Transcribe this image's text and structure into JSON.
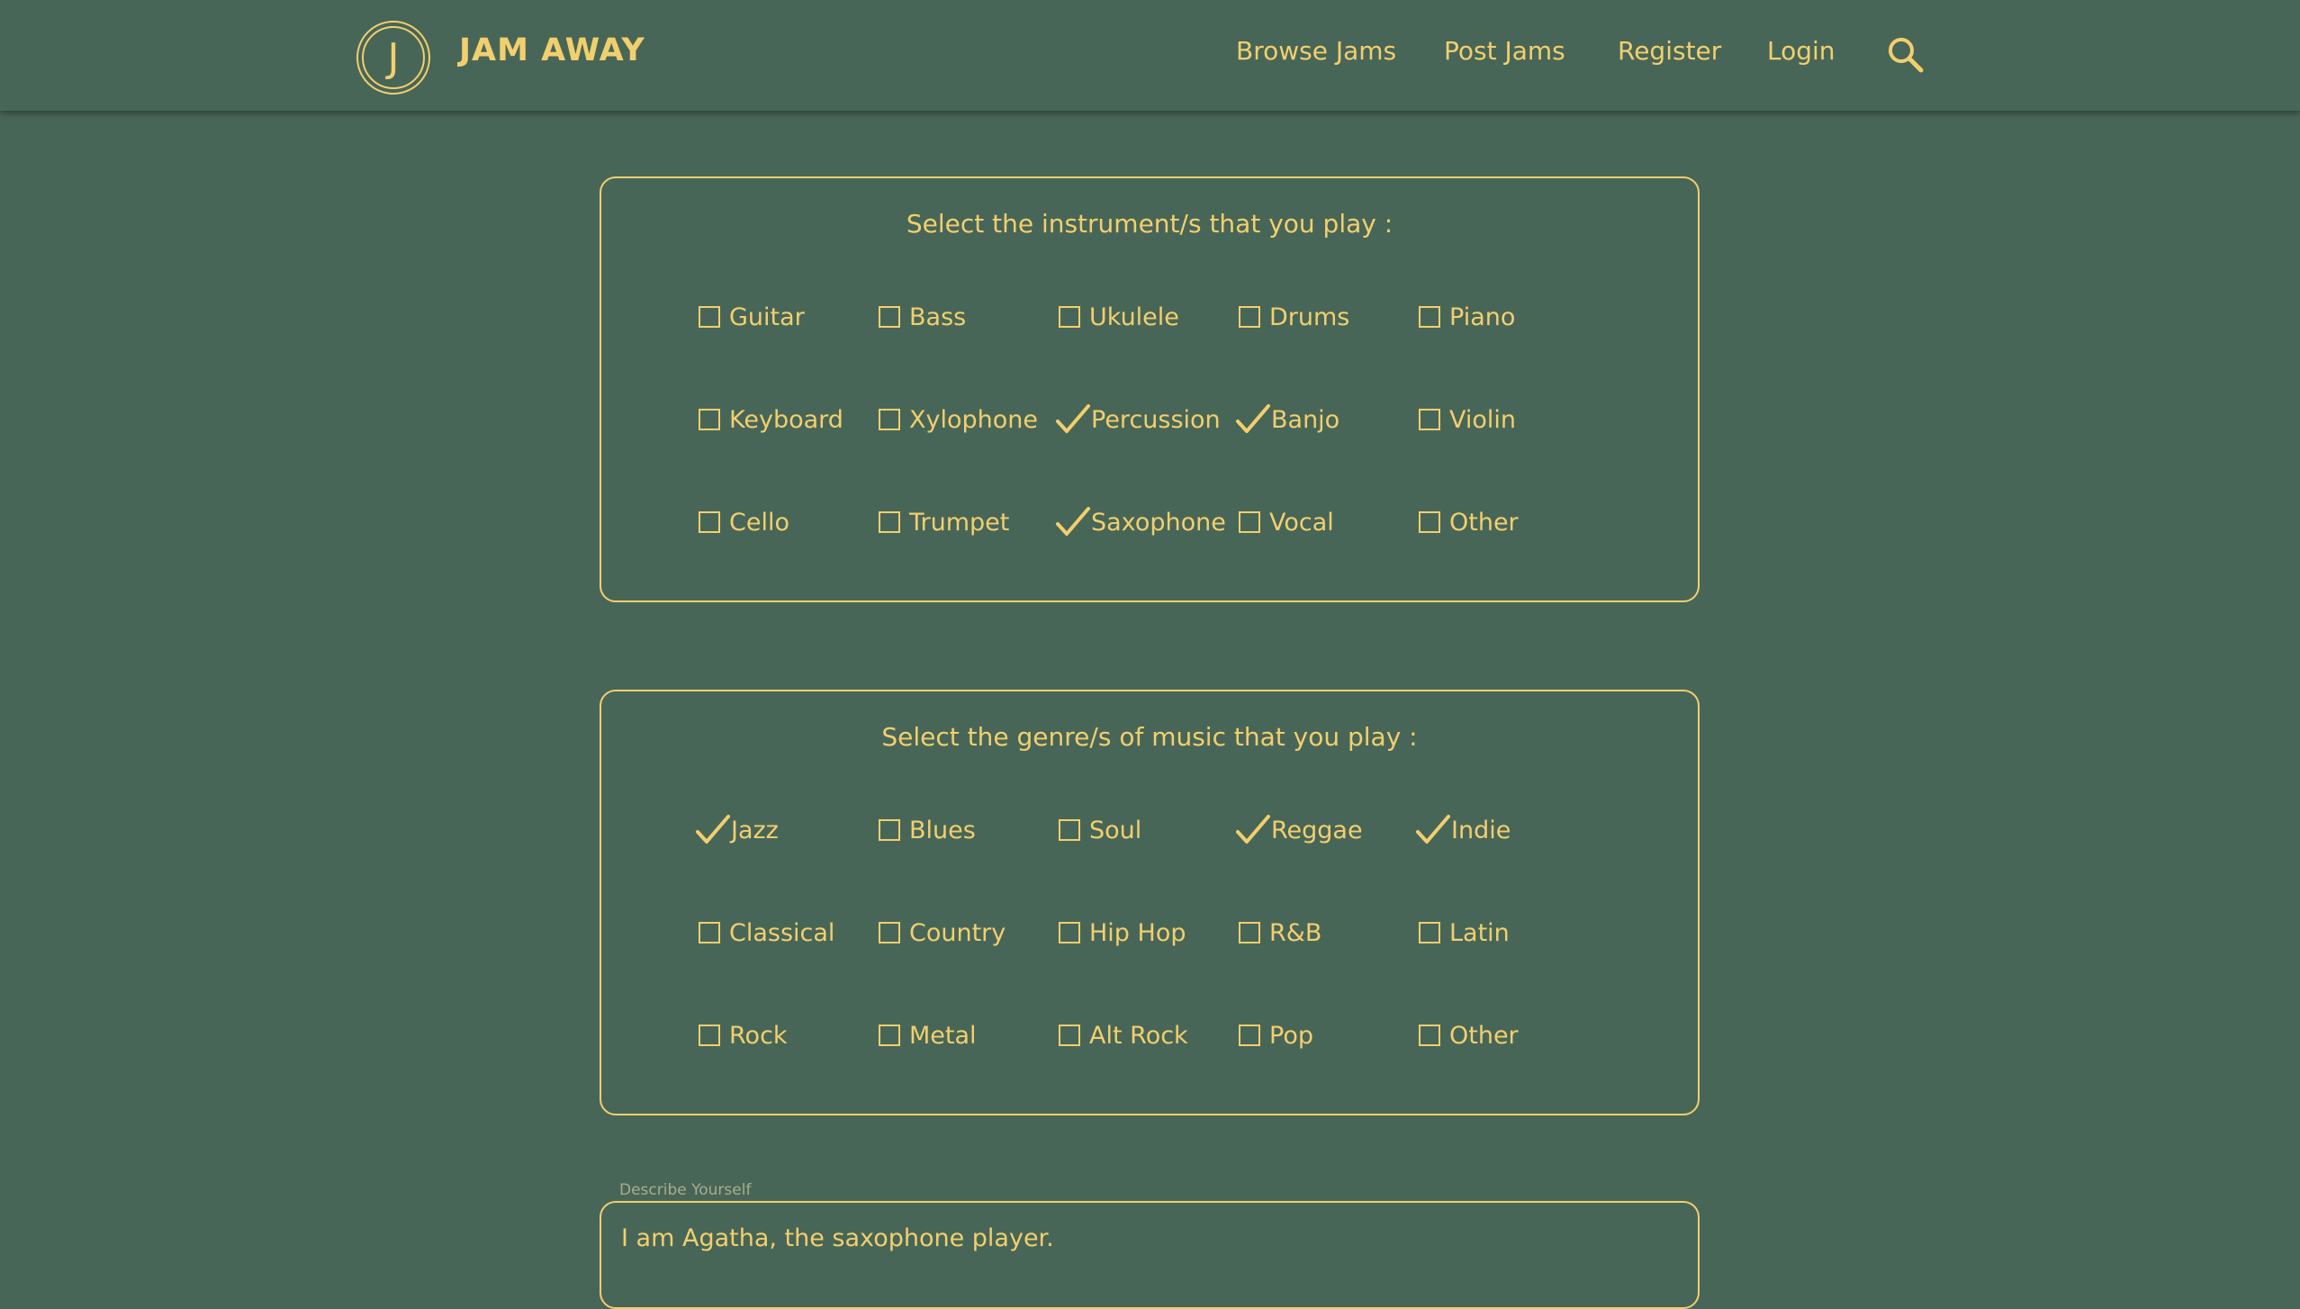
{
  "brand": {
    "logo_letter": "J",
    "name": "JAM AWAY"
  },
  "nav": {
    "items": [
      {
        "label": "Browse Jams"
      },
      {
        "label": "Post Jams"
      },
      {
        "label": "Register"
      },
      {
        "label": "Login"
      }
    ],
    "search_icon": "search-icon"
  },
  "instruments": {
    "title": "Select the instrument/s that you play :",
    "options": [
      {
        "label": "Guitar",
        "checked": false
      },
      {
        "label": "Bass",
        "checked": false
      },
      {
        "label": "Ukulele",
        "checked": false
      },
      {
        "label": "Drums",
        "checked": false
      },
      {
        "label": "Piano",
        "checked": false
      },
      {
        "label": "Keyboard",
        "checked": false
      },
      {
        "label": "Xylophone",
        "checked": false
      },
      {
        "label": "Percussion",
        "checked": true
      },
      {
        "label": "Banjo",
        "checked": true
      },
      {
        "label": "Violin",
        "checked": false
      },
      {
        "label": "Cello",
        "checked": false
      },
      {
        "label": "Trumpet",
        "checked": false
      },
      {
        "label": "Saxophone",
        "checked": true
      },
      {
        "label": "Vocal",
        "checked": false
      },
      {
        "label": "Other",
        "checked": false
      }
    ]
  },
  "genres": {
    "title": "Select the genre/s of music that you play :",
    "options": [
      {
        "label": "Jazz",
        "checked": true
      },
      {
        "label": "Blues",
        "checked": false
      },
      {
        "label": "Soul",
        "checked": false
      },
      {
        "label": "Reggae",
        "checked": true
      },
      {
        "label": "Indie",
        "checked": true
      },
      {
        "label": "Classical",
        "checked": false
      },
      {
        "label": "Country",
        "checked": false
      },
      {
        "label": "Hip Hop",
        "checked": false
      },
      {
        "label": "R&B",
        "checked": false
      },
      {
        "label": "Latin",
        "checked": false
      },
      {
        "label": "Rock",
        "checked": false
      },
      {
        "label": "Metal",
        "checked": false
      },
      {
        "label": "Alt Rock",
        "checked": false
      },
      {
        "label": "Pop",
        "checked": false
      },
      {
        "label": "Other",
        "checked": false
      }
    ]
  },
  "describe": {
    "label": "Describe Yourself",
    "value": "I am Agatha, the saxophone player."
  },
  "colors": {
    "background": "#486657",
    "accent": "#f2cf6e",
    "muted_label": "#a7ad8a"
  }
}
